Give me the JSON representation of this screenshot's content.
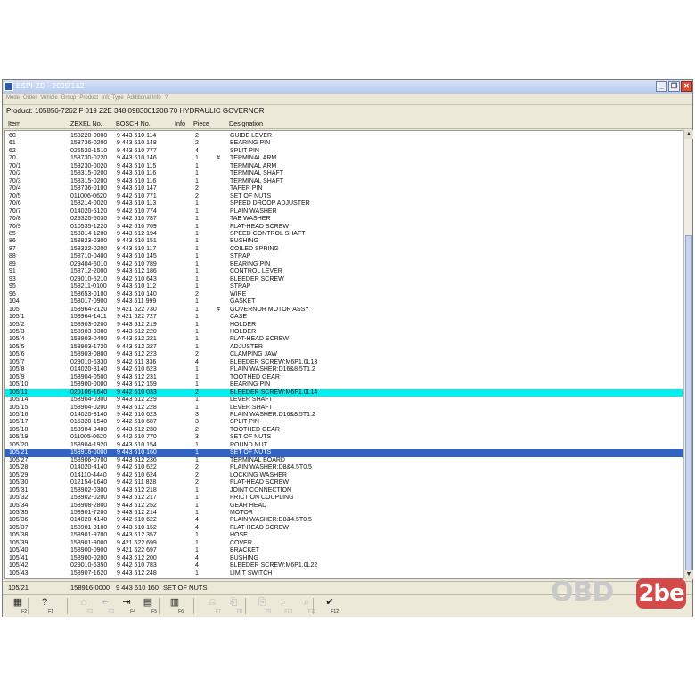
{
  "window": {
    "title": "ESPI-ZD - 2005/1&2"
  },
  "menu": [
    "Mode",
    "Order",
    "Vehicle",
    "Group",
    "Product",
    "Info Type",
    "Additional Info",
    "?"
  ],
  "product": {
    "label": "Product:",
    "text": "105856-7262  F 019 Z2E 348  0983001208 70  HYDRAULIC GOVERNOR"
  },
  "columns": {
    "item": "Item",
    "zexel": "ZEXEL No.",
    "bosch": "BOSCH No.",
    "info": "Info",
    "piece": "Piece",
    "designation": "Designation"
  },
  "rows": [
    {
      "item": "60",
      "zexel": "158220-0000",
      "bosch": "9 443 610 114",
      "piece": "2",
      "info": "",
      "desig": "GUIDE LEVER"
    },
    {
      "item": "61",
      "zexel": "158736-0200",
      "bosch": "9 443 610 148",
      "piece": "2",
      "info": "",
      "desig": "BEARING PIN"
    },
    {
      "item": "62",
      "zexel": "025520-1510",
      "bosch": "9 443 610 777",
      "piece": "4",
      "info": "",
      "desig": "SPLIT PIN"
    },
    {
      "item": "70",
      "zexel": "158730-0220",
      "bosch": "9 443 610 146",
      "piece": "1",
      "info": "#",
      "desig": "TERMINAL ARM"
    },
    {
      "item": "70/1",
      "zexel": "158230-0020",
      "bosch": "9 443 610 115",
      "piece": "1",
      "info": "",
      "desig": "TERMINAL ARM"
    },
    {
      "item": "70/2",
      "zexel": "158315-0200",
      "bosch": "9 443 610 116",
      "piece": "1",
      "info": "",
      "desig": "TERMINAL SHAFT"
    },
    {
      "item": "70/3",
      "zexel": "158315-0200",
      "bosch": "9 443 610 116",
      "piece": "1",
      "info": "",
      "desig": "TERMINAL SHAFT"
    },
    {
      "item": "70/4",
      "zexel": "158736-0100",
      "bosch": "9 443 610 147",
      "piece": "2",
      "info": "",
      "desig": "TAPER PIN"
    },
    {
      "item": "70/5",
      "zexel": "011006-0620",
      "bosch": "9 442 610 771",
      "piece": "2",
      "info": "",
      "desig": "SET OF NUTS"
    },
    {
      "item": "70/6",
      "zexel": "158214-0020",
      "bosch": "9 443 610 113",
      "piece": "1",
      "info": "",
      "desig": "SPEED DROOP ADJUSTER"
    },
    {
      "item": "70/7",
      "zexel": "014020-5120",
      "bosch": "9 442 610 774",
      "piece": "1",
      "info": "",
      "desig": "PLAIN WASHER"
    },
    {
      "item": "70/8",
      "zexel": "029320-5030",
      "bosch": "9 442 610 787",
      "piece": "1",
      "info": "",
      "desig": "TAB WASHER"
    },
    {
      "item": "70/9",
      "zexel": "010535-1220",
      "bosch": "9 442 610 769",
      "piece": "1",
      "info": "",
      "desig": "FLAT-HEAD SCREW"
    },
    {
      "item": "85",
      "zexel": "158814-1200",
      "bosch": "9 443 612 194",
      "piece": "1",
      "info": "",
      "desig": "SPEED CONTROL SHAFT"
    },
    {
      "item": "86",
      "zexel": "158823-0300",
      "bosch": "9 443 610 151",
      "piece": "1",
      "info": "",
      "desig": "BUSHING"
    },
    {
      "item": "87",
      "zexel": "158322-0200",
      "bosch": "9 443 610 117",
      "piece": "1",
      "info": "",
      "desig": "COILED SPRING"
    },
    {
      "item": "88",
      "zexel": "158710-0400",
      "bosch": "9 443 610 145",
      "piece": "1",
      "info": "",
      "desig": "STRAP"
    },
    {
      "item": "89",
      "zexel": "029404-5010",
      "bosch": "9 442 610 789",
      "piece": "1",
      "info": "",
      "desig": "BEARING PIN"
    },
    {
      "item": "91",
      "zexel": "158712-2000",
      "bosch": "9 443 612 186",
      "piece": "1",
      "info": "",
      "desig": "CONTROL LEVER"
    },
    {
      "item": "93",
      "zexel": "029010-5210",
      "bosch": "9 442 610 643",
      "piece": "1",
      "info": "",
      "desig": "BLEEDER SCREW"
    },
    {
      "item": "95",
      "zexel": "158211-0100",
      "bosch": "9 443 610 112",
      "piece": "1",
      "info": "",
      "desig": "STRAP"
    },
    {
      "item": "96",
      "zexel": "158653-0100",
      "bosch": "9 443 610 140",
      "piece": "2",
      "info": "",
      "desig": "WIRE"
    },
    {
      "item": "104",
      "zexel": "158017-0900",
      "bosch": "9 443 611 999",
      "piece": "1",
      "info": "",
      "desig": "GASKET"
    },
    {
      "item": "105",
      "zexel": "158964-2120",
      "bosch": "9 421 622 730",
      "piece": "1",
      "info": "#",
      "desig": "GOVERNOR MOTOR ASSY"
    },
    {
      "item": "105/1",
      "zexel": "158964-1411",
      "bosch": "9 421 622 727",
      "piece": "1",
      "info": "",
      "desig": "CASE"
    },
    {
      "item": "105/2",
      "zexel": "158903-0200",
      "bosch": "9 443 612 219",
      "piece": "1",
      "info": "",
      "desig": "HOLDER"
    },
    {
      "item": "105/3",
      "zexel": "158903-0300",
      "bosch": "9 443 612 220",
      "piece": "1",
      "info": "",
      "desig": "HOLDER"
    },
    {
      "item": "105/4",
      "zexel": "158903-0400",
      "bosch": "9 443 612 221",
      "piece": "1",
      "info": "",
      "desig": "FLAT-HEAD SCREW"
    },
    {
      "item": "105/5",
      "zexel": "158903-1720",
      "bosch": "9 443 612 227",
      "piece": "1",
      "info": "",
      "desig": "ADJUSTER"
    },
    {
      "item": "105/6",
      "zexel": "158903-0800",
      "bosch": "9 443 612 223",
      "piece": "2",
      "info": "",
      "desig": "CLAMPING JAW"
    },
    {
      "item": "105/7",
      "zexel": "029010-6330",
      "bosch": "9 442 611 336",
      "piece": "4",
      "info": "",
      "desig": "BLEEDER SCREW:M6P1.0L13"
    },
    {
      "item": "105/8",
      "zexel": "014020-8140",
      "bosch": "9 442 610 623",
      "piece": "1",
      "info": "",
      "desig": "PLAIN WASHER:D16&8.5T1.2"
    },
    {
      "item": "105/9",
      "zexel": "158904-0500",
      "bosch": "9 443 612 231",
      "piece": "1",
      "info": "",
      "desig": "TOOTHED GEAR"
    },
    {
      "item": "105/10",
      "zexel": "158900-0000",
      "bosch": "9 443 612 159",
      "piece": "1",
      "info": "",
      "desig": "BEARING PIN"
    },
    {
      "item": "105/11",
      "zexel": "020106-1640",
      "bosch": "9 442 610 033",
      "piece": "2",
      "info": "",
      "desig": "BLEEDER SCREW:M6P1.0L14",
      "hl": "cyan"
    },
    {
      "item": "105/14",
      "zexel": "158904-0300",
      "bosch": "9 443 612 229",
      "piece": "1",
      "info": "",
      "desig": "LEVER SHAFT"
    },
    {
      "item": "105/15",
      "zexel": "158904-0200",
      "bosch": "9 443 612 228",
      "piece": "1",
      "info": "",
      "desig": "LEVER SHAFT"
    },
    {
      "item": "105/16",
      "zexel": "014020-8140",
      "bosch": "9 442 610 623",
      "piece": "3",
      "info": "",
      "desig": "PLAIN WASHER:D16&8.5T1.2"
    },
    {
      "item": "105/17",
      "zexel": "015320-1540",
      "bosch": "9 442 610 687",
      "piece": "3",
      "info": "",
      "desig": "SPLIT PIN"
    },
    {
      "item": "105/18",
      "zexel": "158904-0400",
      "bosch": "9 443 612 230",
      "piece": "2",
      "info": "",
      "desig": "TOOTHED GEAR"
    },
    {
      "item": "105/19",
      "zexel": "011005-0620",
      "bosch": "9 442 610 770",
      "piece": "3",
      "info": "",
      "desig": "SET OF NUTS"
    },
    {
      "item": "105/20",
      "zexel": "158904-1920",
      "bosch": "9 443 610 154",
      "piece": "1",
      "info": "",
      "desig": "ROUND NUT"
    },
    {
      "item": "105/21",
      "zexel": "158916-0000",
      "bosch": "9 443 610 160",
      "piece": "1",
      "info": "",
      "desig": "SET OF NUTS",
      "hl": "sel"
    },
    {
      "item": "105/27",
      "zexel": "158906-0700",
      "bosch": "9 443 612 236",
      "piece": "1",
      "info": "",
      "desig": "TERMINAL BOARD"
    },
    {
      "item": "105/28",
      "zexel": "014020-4140",
      "bosch": "9 442 610 622",
      "piece": "2",
      "info": "",
      "desig": "PLAIN WASHER:D8&4.5T0.5"
    },
    {
      "item": "105/29",
      "zexel": "014110-4440",
      "bosch": "9 442 610 624",
      "piece": "2",
      "info": "",
      "desig": "LOCKING WASHER"
    },
    {
      "item": "105/30",
      "zexel": "012154-1640",
      "bosch": "9 442 611 828",
      "piece": "2",
      "info": "",
      "desig": "FLAT-HEAD SCREW"
    },
    {
      "item": "105/31",
      "zexel": "158902-0300",
      "bosch": "9 443 612 218",
      "piece": "1",
      "info": "",
      "desig": "JOINT CONNECTION"
    },
    {
      "item": "105/32",
      "zexel": "158902-0200",
      "bosch": "9 443 612 217",
      "piece": "1",
      "info": "",
      "desig": "FRICTION COUPLING"
    },
    {
      "item": "105/34",
      "zexel": "158908-2800",
      "bosch": "9 443 612 252",
      "piece": "1",
      "info": "",
      "desig": "GEAR HEAD"
    },
    {
      "item": "105/35",
      "zexel": "158901-7200",
      "bosch": "9 443 612 214",
      "piece": "1",
      "info": "",
      "desig": "MOTOR"
    },
    {
      "item": "105/36",
      "zexel": "014020-4140",
      "bosch": "9 442 610 622",
      "piece": "4",
      "info": "",
      "desig": "PLAIN WASHER:D8&4.5T0.5"
    },
    {
      "item": "105/37",
      "zexel": "158901-8100",
      "bosch": "9 443 610 152",
      "piece": "4",
      "info": "",
      "desig": "FLAT-HEAD SCREW"
    },
    {
      "item": "105/38",
      "zexel": "158901-9700",
      "bosch": "9 443 612 357",
      "piece": "1",
      "info": "",
      "desig": "HOSE"
    },
    {
      "item": "105/39",
      "zexel": "158901-9000",
      "bosch": "9 421 622 699",
      "piece": "1",
      "info": "",
      "desig": "COVER"
    },
    {
      "item": "105/40",
      "zexel": "158900-0900",
      "bosch": "9 421 622 697",
      "piece": "1",
      "info": "",
      "desig": "BRACKET"
    },
    {
      "item": "105/41",
      "zexel": "158900-0200",
      "bosch": "9 443 612 200",
      "piece": "4",
      "info": "",
      "desig": "BUSHING"
    },
    {
      "item": "105/42",
      "zexel": "029010-6350",
      "bosch": "9 442 610 783",
      "piece": "4",
      "info": "",
      "desig": "BLEEDER SCREW:M6P1.0L22"
    },
    {
      "item": "105/43",
      "zexel": "158907-1620",
      "bosch": "9 443 612 248",
      "piece": "1",
      "info": "",
      "desig": "LIMIT SWITCH"
    }
  ],
  "status": {
    "item": "105/21",
    "zexel": "158916-0000",
    "bosch": "9 443 610 160",
    "desig": "SET OF NUTS"
  },
  "toolbar": [
    {
      "id": "f2",
      "icon": "▦",
      "key": "F2",
      "enabled": true
    },
    {
      "id": "f1",
      "icon": "?",
      "key": "F1",
      "enabled": true
    },
    {
      "id": "f3",
      "icon": "⌂",
      "key": "F3",
      "enabled": false
    },
    {
      "id": "f3b",
      "icon": "⇤",
      "key": "F3",
      "enabled": false
    },
    {
      "id": "f4",
      "icon": "⇥",
      "key": "F4",
      "enabled": true
    },
    {
      "id": "f5",
      "icon": "▤",
      "key": "F5",
      "enabled": true
    },
    {
      "id": "f6",
      "icon": "▥",
      "key": "F6",
      "enabled": true
    },
    {
      "id": "f7",
      "icon": "⎌",
      "key": "F7",
      "enabled": false
    },
    {
      "id": "f8",
      "icon": "⎗",
      "key": "F8",
      "enabled": false
    },
    {
      "id": "f9",
      "icon": "⎘",
      "key": "F9",
      "enabled": false
    },
    {
      "id": "f10",
      "icon": "⌕",
      "key": "F10",
      "enabled": false
    },
    {
      "id": "f11",
      "icon": "⌕",
      "key": "F11",
      "enabled": false
    },
    {
      "id": "f12",
      "icon": "✔",
      "key": "F12",
      "enabled": true
    }
  ],
  "watermark": {
    "text1": "OBD",
    "text2": "2be"
  }
}
